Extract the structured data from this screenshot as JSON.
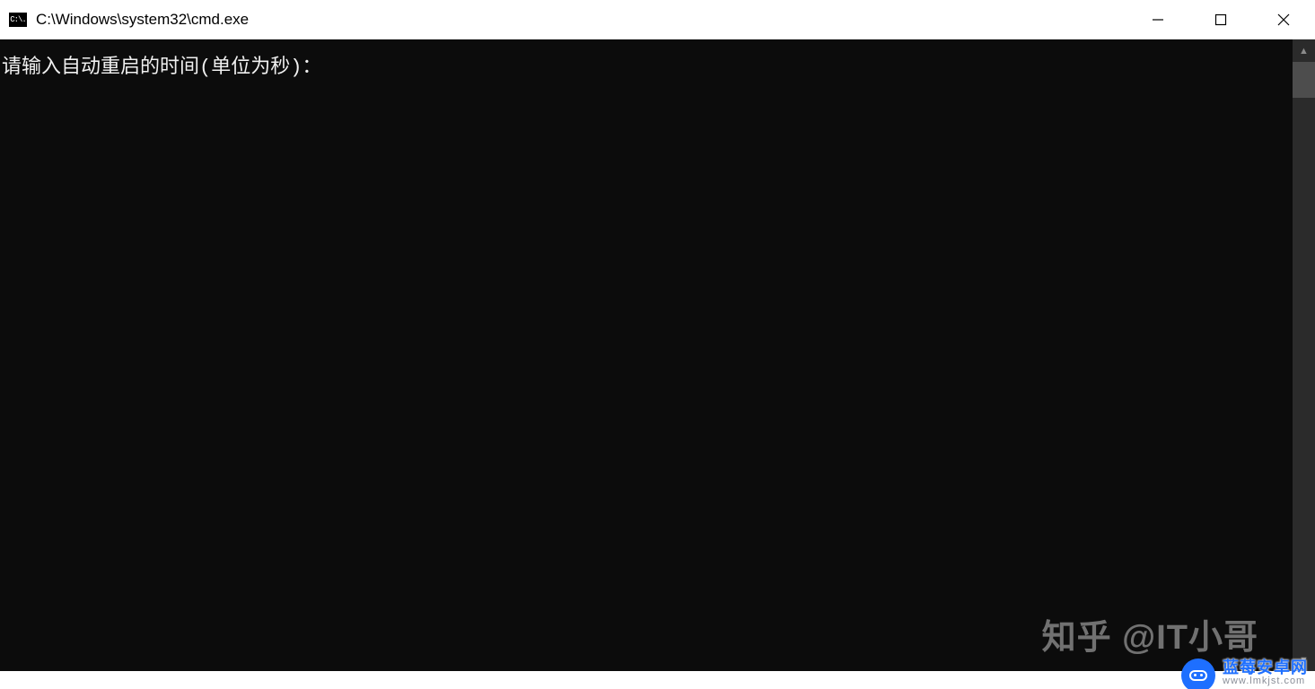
{
  "window": {
    "title": "C:\\Windows\\system32\\cmd.exe",
    "icon_label": "C:\\."
  },
  "terminal": {
    "prompt_line": "请输入自动重启的时间(单位为秒)："
  },
  "watermarks": {
    "zhihu": "知乎 @IT小哥",
    "site_name": "蓝莓安卓网",
    "site_url": "www.lmkjst.com"
  }
}
